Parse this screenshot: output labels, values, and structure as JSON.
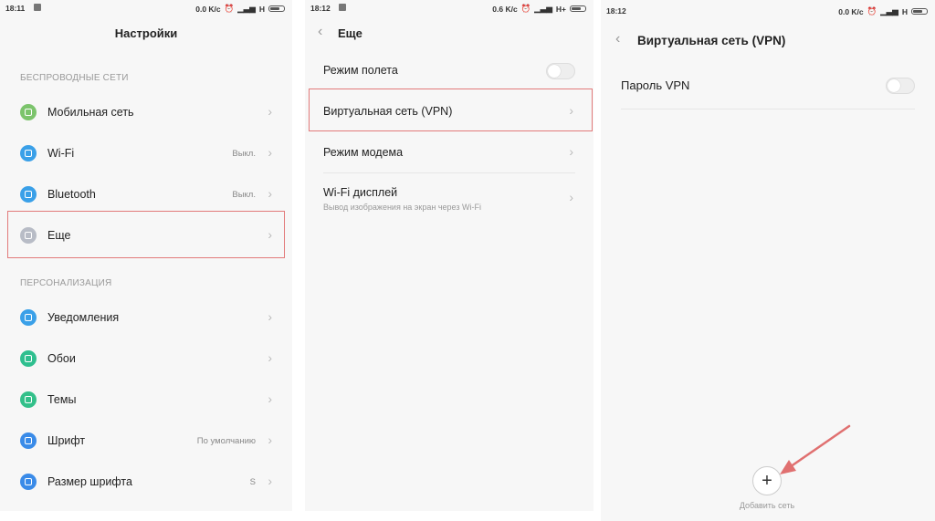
{
  "panel1": {
    "status": {
      "time": "18:11",
      "right": "0.0 K/c",
      "net": "H"
    },
    "title": "Настройки",
    "section_wireless": "БЕСПРОВОДНЫЕ СЕТИ",
    "section_personal": "ПЕРСОНАЛИЗАЦИЯ",
    "items": [
      {
        "label": "Мобильная сеть",
        "value": "",
        "color": "#7cc46c"
      },
      {
        "label": "Wi-Fi",
        "value": "Выкл.",
        "color": "#3aa0e8"
      },
      {
        "label": "Bluetooth",
        "value": "Выкл.",
        "color": "#3aa0e8"
      },
      {
        "label": "Еще",
        "value": "",
        "color": "#b8bcc6"
      },
      {
        "label": "Уведомления",
        "value": "",
        "color": "#3aa0e8"
      },
      {
        "label": "Обои",
        "value": "",
        "color": "#2fbf8f"
      },
      {
        "label": "Темы",
        "value": "",
        "color": "#33c08a"
      },
      {
        "label": "Шрифт",
        "value": "По умолчанию",
        "color": "#3a8be8"
      },
      {
        "label": "Размер шрифта",
        "value": "S",
        "color": "#3a8be8"
      }
    ]
  },
  "panel2": {
    "status": {
      "time": "18:12",
      "right": "0.6 K/c",
      "net": "H+"
    },
    "title": "Еще",
    "items": [
      {
        "label": "Режим полета",
        "sub": ""
      },
      {
        "label": "Виртуальная сеть (VPN)",
        "sub": ""
      },
      {
        "label": "Режим модема",
        "sub": ""
      },
      {
        "label": "Wi-Fi дисплей",
        "sub": "Вывод изображения на экран через Wi-Fi"
      }
    ]
  },
  "panel3": {
    "status": {
      "time": "18:12",
      "right": "0.0 K/c",
      "net": "H"
    },
    "title": "Виртуальная сеть (VPN)",
    "vpn_password_label": "Пароль VPN",
    "add_label": "Добавить сеть",
    "plus": "+"
  },
  "colors": {
    "highlight": "#e27a7a",
    "arrow": "#e07070"
  }
}
